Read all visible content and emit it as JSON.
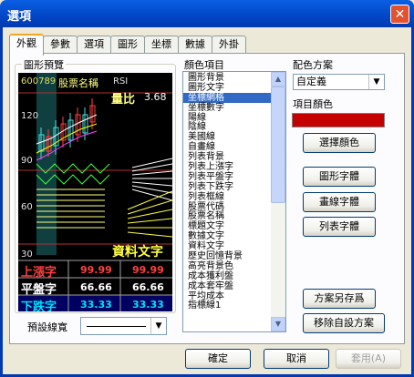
{
  "window": {
    "title": "選項",
    "close_glyph": "✕"
  },
  "tabs": [
    "外觀",
    "參數",
    "選項",
    "圖形",
    "坐標",
    "數據",
    "外掛"
  ],
  "preview": {
    "group_label": "圖形預覽",
    "stock_code": "600789",
    "stock_name": "股票名稱",
    "indicator": "RSI",
    "volume_label": "量比",
    "volume_value": "3.68",
    "y_ticks": [
      "120",
      "90",
      "60",
      "30"
    ],
    "data_text": "資料文字",
    "rows": [
      {
        "label": "上漲字",
        "v1": "99.99",
        "v2": "99.99",
        "color": "#ff4040"
      },
      {
        "label": "平盤字",
        "v1": "66.66",
        "v2": "66.66",
        "color": "#ffffff"
      },
      {
        "label": "下跌字",
        "v1": "33.33",
        "v2": "33.33",
        "color": "#00e0ff"
      }
    ]
  },
  "line_width": {
    "label": "預設線寬"
  },
  "color_items": {
    "label": "顏色項目",
    "items": [
      "圖形背景",
      "圖形文字",
      "坐標網格",
      "坐標數字",
      "陽線",
      "陰線",
      "美國線",
      "自畫線",
      "列表背景",
      "列表上漲字",
      "列表平盤字",
      "列表下跌字",
      "列表框線",
      "股票代碼",
      "股票名稱",
      "標題文字",
      "數據文字",
      "資料文字",
      "歷史回憶背景",
      "高亮背景色",
      "成本獲利盤",
      "成本套牢盤",
      "平均成本",
      "指標線1"
    ],
    "selected_index": 2
  },
  "scheme": {
    "label": "配色方案",
    "value": "自定義"
  },
  "item_color": {
    "label": "項目顏色",
    "color": "#c40000"
  },
  "buttons": {
    "choose_color": "選擇顏色",
    "chart_font": "圖形字體",
    "draw_font": "畫線字體",
    "list_font": "列表字體",
    "save_scheme": "方案另存爲",
    "remove_scheme": "移除自設方案",
    "ok": "確定",
    "cancel": "取消",
    "apply": "套用(A)"
  }
}
